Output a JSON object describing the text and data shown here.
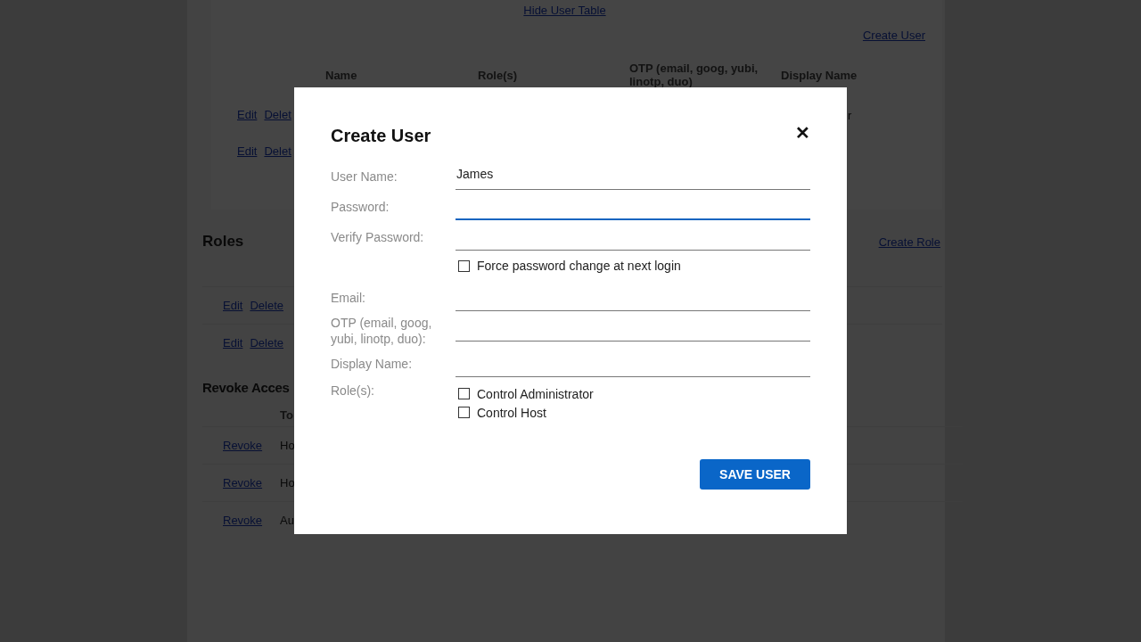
{
  "background": {
    "hide_link": "Hide User Table",
    "create_user_link": "Create User",
    "user_table": {
      "columns": [
        "Name",
        "Role(s)",
        "OTP (email, goog, yubi, linotp, duo)",
        "Display Name"
      ],
      "rows": [
        {
          "actions": [
            "Edit",
            "Delet"
          ],
          "column_4": "r"
        },
        {
          "actions": [
            "Edit",
            "Delet"
          ]
        }
      ]
    },
    "roles": {
      "title": "Roles",
      "create_link": "Create Role",
      "rows": [
        {
          "actions": [
            "Edit",
            "Delete"
          ]
        },
        {
          "actions": [
            "Edit",
            "Delete"
          ]
        }
      ]
    },
    "revoke": {
      "title": "Revoke Acces",
      "column_2": "To",
      "rows": [
        {
          "action": "Revoke",
          "column_2": "Ho"
        },
        {
          "action": "Revoke",
          "column_2": "Ho"
        },
        {
          "action": "Revoke",
          "column_2": "Au"
        }
      ]
    }
  },
  "dialog": {
    "title": "Create User",
    "close": "✕",
    "fields": [
      {
        "kind": "input",
        "label": "User Name:",
        "value": "James",
        "focused": false
      },
      {
        "kind": "input",
        "label": "Password:",
        "focused": true
      },
      {
        "kind": "input",
        "label": "Verify Password:",
        "focused": false
      },
      {
        "kind": "checkbox",
        "label": "Force password change at next login",
        "checked": false
      },
      {
        "kind": "input",
        "label": "Email:",
        "focused": false
      },
      {
        "kind": "input",
        "label": "OTP (email, goog, yubi, linotp, duo):",
        "focused": false
      },
      {
        "kind": "input",
        "label": "Display Name:",
        "focused": false
      },
      {
        "kind": "checkgroup",
        "label": "Role(s):",
        "options": [
          {
            "label": "Control Administrator",
            "checked": false
          },
          {
            "label": "Control Host",
            "checked": false
          }
        ]
      }
    ],
    "save_button": "SAVE USER"
  }
}
